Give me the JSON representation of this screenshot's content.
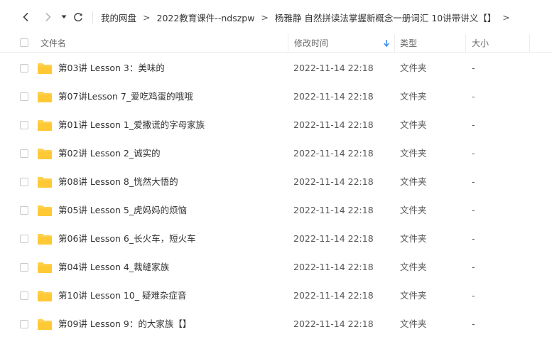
{
  "nav": {
    "breadcrumb": [
      "我的网盘",
      "2022教育课件--ndszpw",
      "杨雅静 自然拼读法掌握新概念一册词汇  10讲带讲义【】"
    ],
    "separator": ">"
  },
  "columns": {
    "name": "文件名",
    "modified": "修改时间",
    "type": "类型",
    "size": "大小"
  },
  "rows": [
    {
      "name": "第03讲 Lesson 3：美味的",
      "modified": "2022-11-14 22:18",
      "type": "文件夹",
      "size": "-"
    },
    {
      "name": "第07讲Lesson 7_爱吃鸡蛋的哦哦",
      "modified": "2022-11-14 22:18",
      "type": "文件夹",
      "size": "-"
    },
    {
      "name": "第01讲 Lesson 1_爱撒谎的字母家族",
      "modified": "2022-11-14 22:18",
      "type": "文件夹",
      "size": "-"
    },
    {
      "name": "第02讲 Lesson 2_诚实的",
      "modified": "2022-11-14 22:18",
      "type": "文件夹",
      "size": "-"
    },
    {
      "name": "第08讲 Lesson 8_恍然大悟的",
      "modified": "2022-11-14 22:18",
      "type": "文件夹",
      "size": "-"
    },
    {
      "name": "第05讲 Lesson 5_虎妈妈的烦恼",
      "modified": "2022-11-14 22:18",
      "type": "文件夹",
      "size": "-"
    },
    {
      "name": "第06讲 Lesson 6_长火车，短火车",
      "modified": "2022-11-14 22:18",
      "type": "文件夹",
      "size": "-"
    },
    {
      "name": "第04讲 Lesson 4_裁缝家族",
      "modified": "2022-11-14 22:18",
      "type": "文件夹",
      "size": "-"
    },
    {
      "name": "第10讲 Lesson 10_ 疑难杂症音",
      "modified": "2022-11-14 22:18",
      "type": "文件夹",
      "size": "-"
    },
    {
      "name": "第09讲 Lesson 9：的大家族【】",
      "modified": "2022-11-14 22:18",
      "type": "文件夹",
      "size": "-"
    }
  ],
  "icons": {
    "back": "chevron-left-icon",
    "forward": "chevron-right-icon",
    "history": "caret-down-icon",
    "refresh": "refresh-icon",
    "folder": "folder-icon",
    "sort": "sort-down-arrow-icon"
  },
  "colors": {
    "folder": "#ffd04d",
    "sort_arrow": "#3b8ff0"
  }
}
